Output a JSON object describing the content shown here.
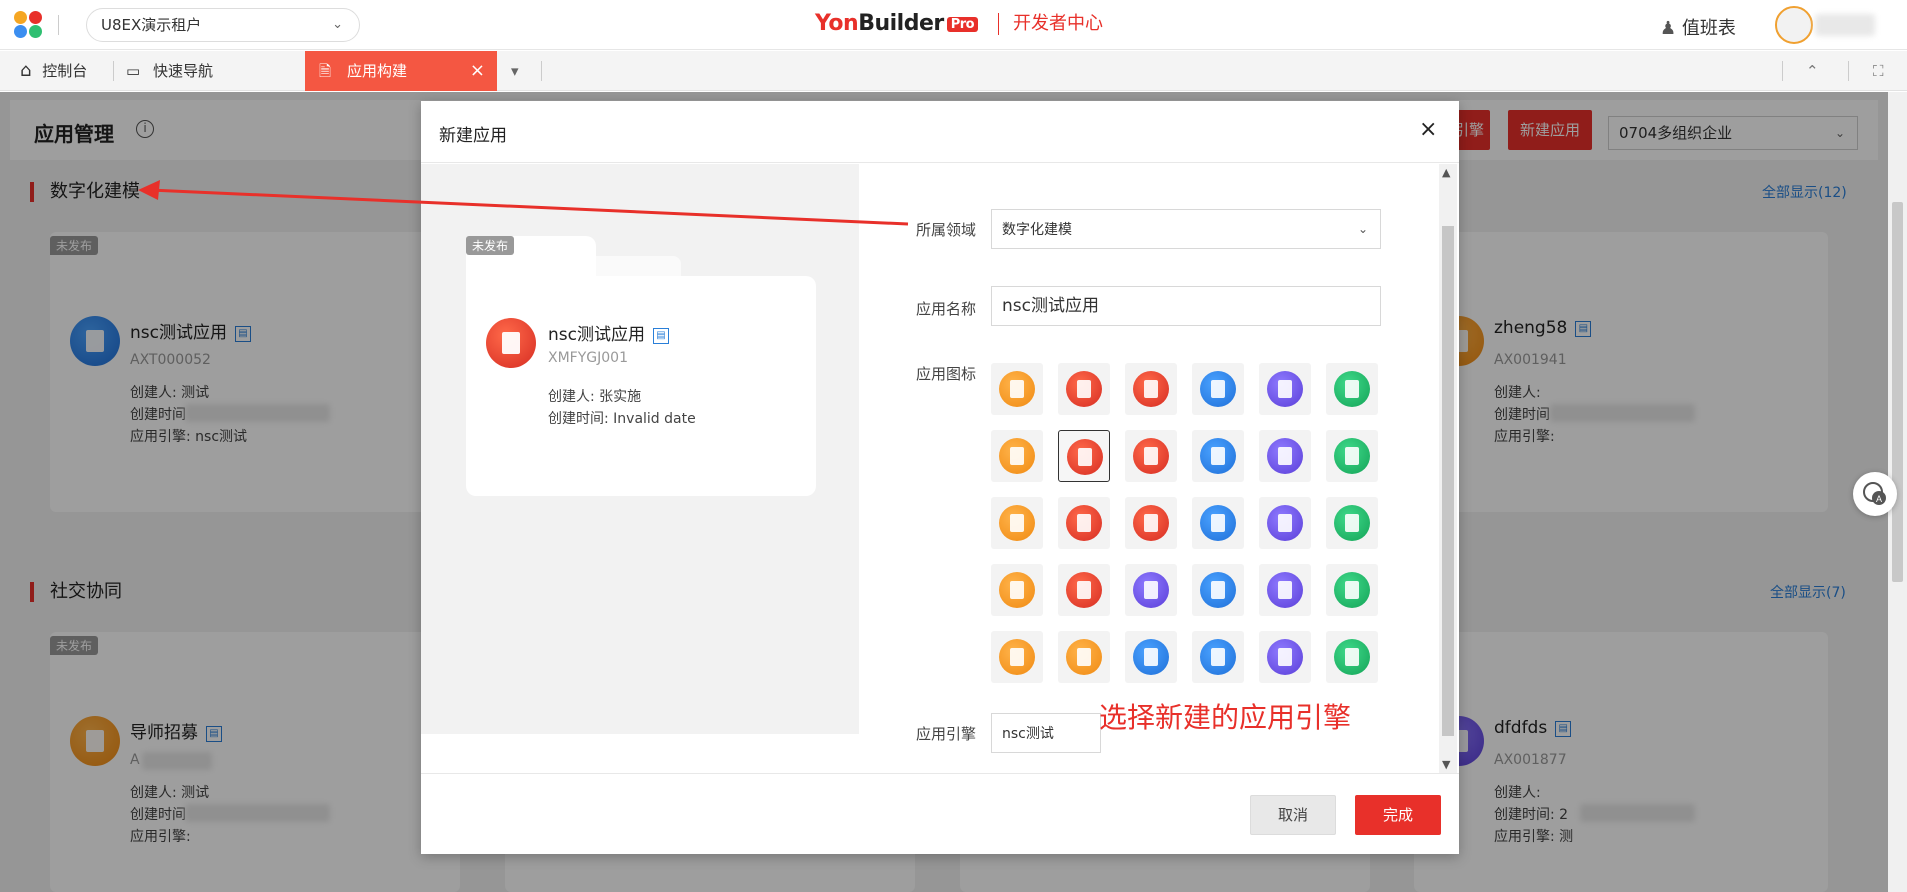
{
  "topbar": {
    "tenant": "U8EX演示租户",
    "brand_yon": "Yon",
    "brand_builder": "Builder",
    "brand_pro": "Pro",
    "dev_center": "开发者中心",
    "duty": "值班表"
  },
  "tabs": {
    "console": "控制台",
    "quick_nav": "快速导航",
    "active": "应用构建",
    "active_close": "×"
  },
  "page": {
    "title": "应用管理",
    "engine_btn_partial": "引擎",
    "new_app_btn": "新建应用",
    "org": "0704多组织企业",
    "sections": [
      {
        "title": "数字化建模",
        "show_all": "全部显示(12)"
      },
      {
        "title": "社交协同",
        "show_all": "全部显示(7)"
      }
    ],
    "unpublished_tag": "未发布",
    "cards": [
      {
        "name": "nsc测试应用",
        "code": "AXT000052",
        "creator": "创建人: 测试",
        "created": "创建时间",
        "engine": "应用引擎: nsc测试"
      },
      {
        "name": "zheng58",
        "code": "AX001941",
        "creator": "创建人:",
        "created": "创建时间",
        "engine": "应用引擎:"
      },
      {
        "name": "导师招募",
        "code": "A",
        "creator": "创建人: 测试",
        "created": "创建时间",
        "engine": "应用引擎:"
      },
      {
        "name": "dfdfds",
        "code": "AX001877",
        "creator": "创建人:",
        "created": "创建时间: 2",
        "engine": "应用引擎: 测"
      }
    ]
  },
  "modal": {
    "title": "新建应用",
    "close": "×",
    "preview": {
      "tag": "未发布",
      "name": "nsc测试应用",
      "code": "XMFYGJ001",
      "creator": "创建人: 张实施",
      "created": "创建时间: Invalid date"
    },
    "form": {
      "domain_label": "所属领域",
      "domain_value": "数字化建模",
      "name_label": "应用名称",
      "name_value": "nsc测试应用",
      "icon_label": "应用图标",
      "engine_label": "应用引擎",
      "engine_value": "nsc测试"
    },
    "icon_rows": [
      [
        "orange",
        "red",
        "red",
        "blue",
        "purple",
        "green"
      ],
      [
        "orange",
        "red",
        "red",
        "blue",
        "purple",
        "green"
      ],
      [
        "orange",
        "red",
        "red",
        "blue",
        "purple",
        "green"
      ],
      [
        "orange",
        "red",
        "purple",
        "blue",
        "purple",
        "green"
      ],
      [
        "orange",
        "orange",
        "blue",
        "blue",
        "purple",
        "green"
      ]
    ],
    "selected_icon": {
      "row": 1,
      "col": 1
    },
    "annotation": "选择新建的应用引擎",
    "cancel": "取消",
    "done": "完成"
  },
  "colors": {
    "accent": "#e8302a",
    "link": "#2a7fd8",
    "orange": "#f59a23",
    "red": "#eb4b3a",
    "blue": "#2a8ff0",
    "purple": "#7b5ce8",
    "green": "#21b566"
  }
}
